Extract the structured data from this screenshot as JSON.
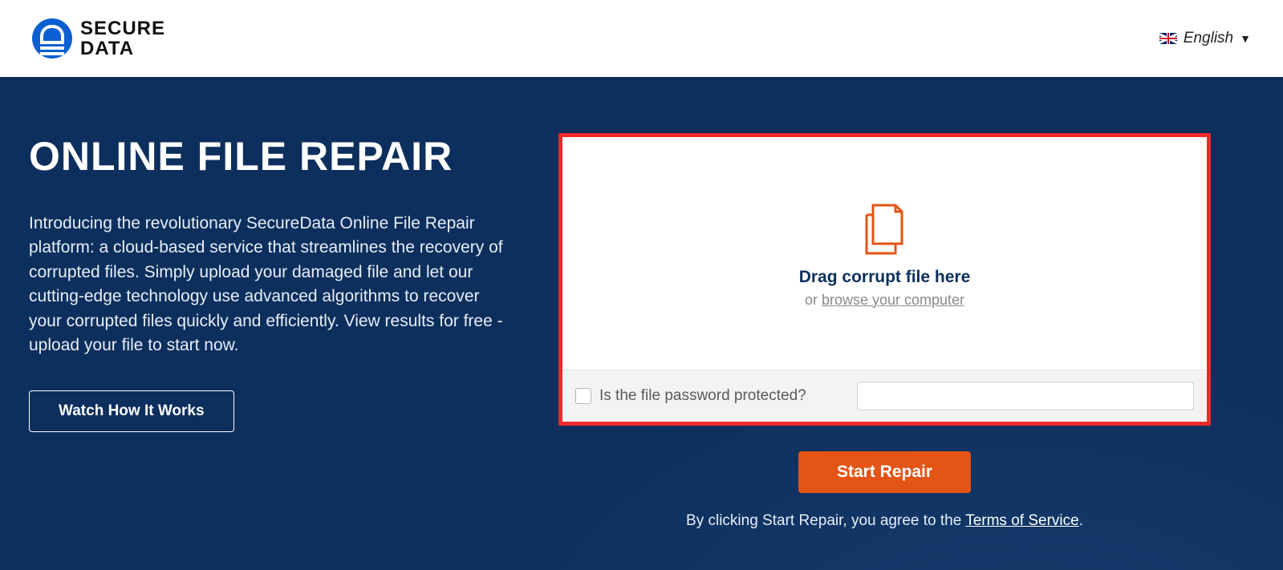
{
  "header": {
    "brand_line1": "SECURE",
    "brand_line2": "DATA",
    "language": "English"
  },
  "hero": {
    "title": "ONLINE FILE REPAIR",
    "description": "Introducing the revolutionary SecureData Online File Repair platform: a cloud-based service that streamlines the recovery of corrupted files. Simply upload your damaged file and let our cutting-edge technology use advanced algorithms to recover your corrupted files quickly and efficiently. View results for free - upload your file to start now.",
    "watch_button": "Watch How It Works"
  },
  "upload": {
    "drop_text": "Drag corrupt file here",
    "or_text": "or ",
    "browse_text": "browse your computer",
    "password_label": "Is the file password protected?",
    "password_placeholder": ""
  },
  "actions": {
    "start_button": "Start Repair",
    "terms_prefix": "By clicking Start Repair, you agree to the ",
    "terms_link": "Terms of Service",
    "terms_suffix": "."
  }
}
